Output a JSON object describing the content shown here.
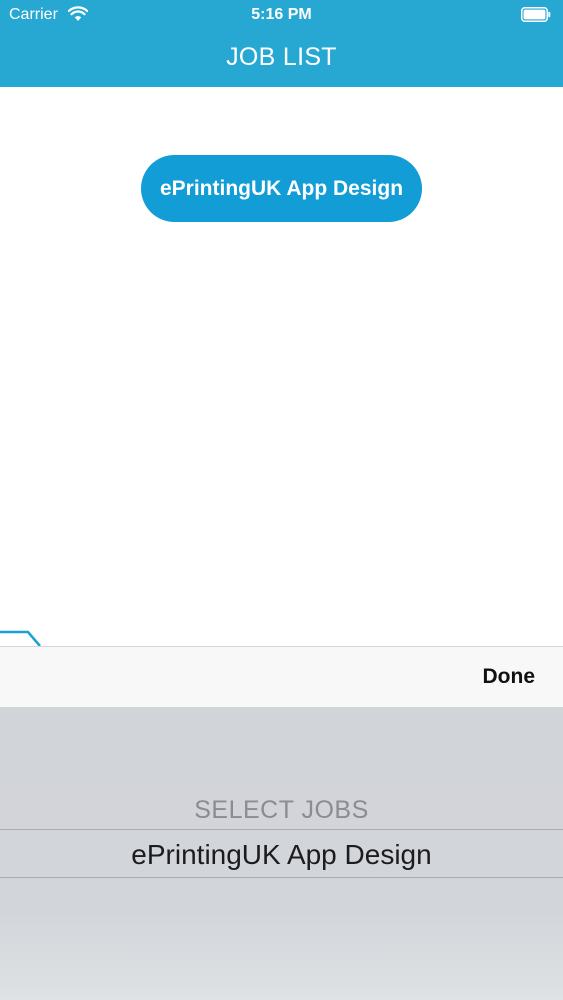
{
  "status_bar": {
    "carrier": "Carrier",
    "time": "5:16 PM"
  },
  "nav": {
    "title": "JOB LIST"
  },
  "content": {
    "job_button_label": "ePrintingUK App Design"
  },
  "toolbar": {
    "done_label": "Done"
  },
  "picker": {
    "header": "SELECT JOBS",
    "selected_option": "ePrintingUK App Design"
  },
  "colors": {
    "nav_blue": "#27a8d3",
    "pill_blue": "#129dd6",
    "picker_gray": "#d1d4d9"
  }
}
